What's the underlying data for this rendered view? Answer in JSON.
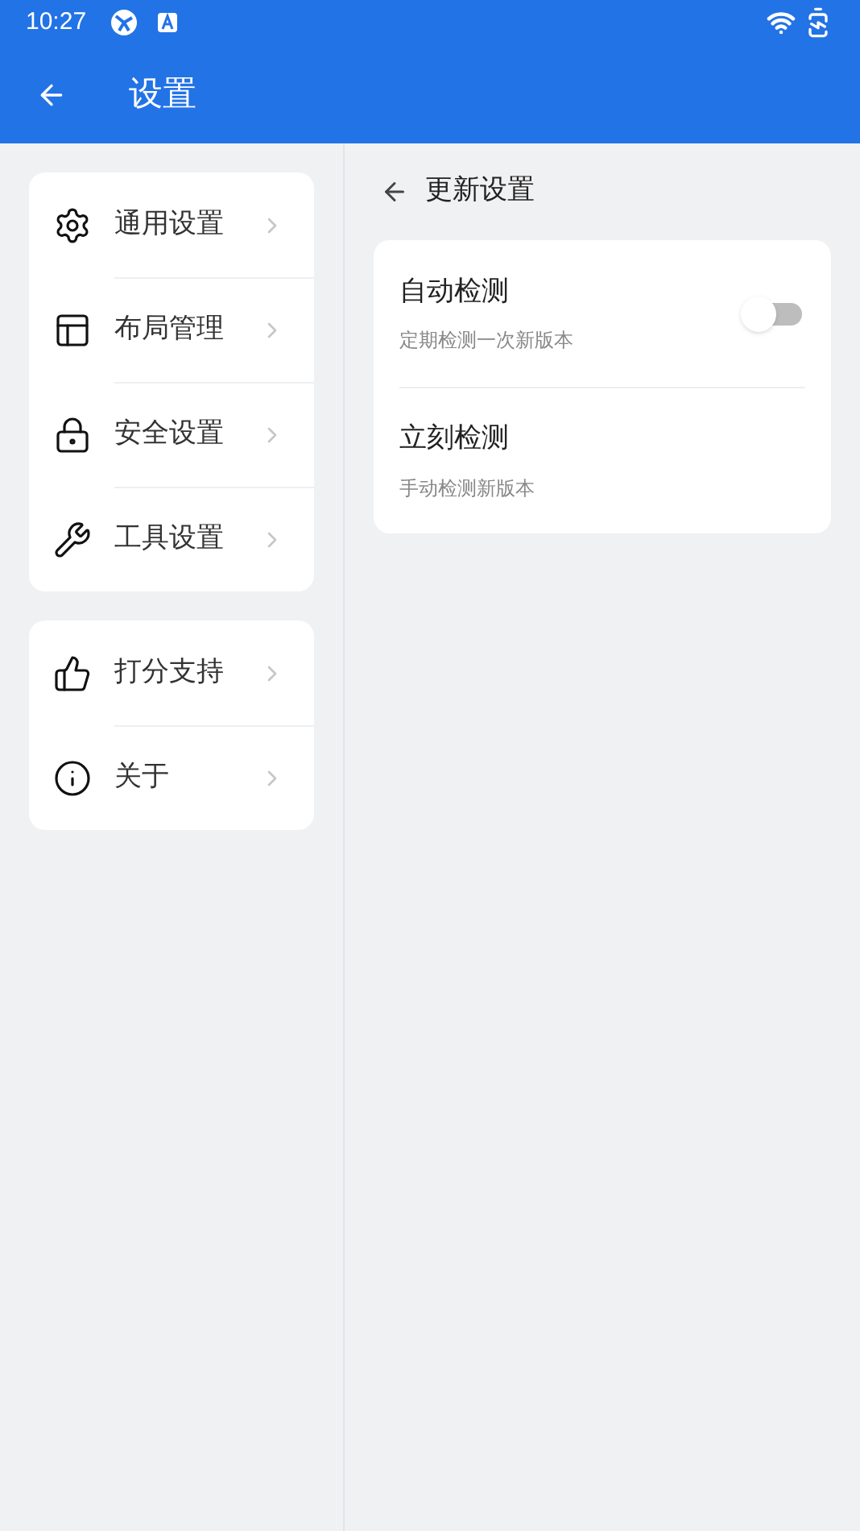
{
  "status_bar": {
    "time": "10:27"
  },
  "app_bar": {
    "title": "设置"
  },
  "sidebar": {
    "groups": [
      {
        "items": [
          {
            "label": "通用设置",
            "selected": false
          },
          {
            "label": "布局管理",
            "selected": false
          },
          {
            "label": "安全设置",
            "selected": false
          },
          {
            "label": "工具设置",
            "selected": false
          }
        ]
      },
      {
        "items": [
          {
            "label": "打分支持",
            "selected": false
          },
          {
            "label": "关于",
            "selected": false
          }
        ]
      }
    ]
  },
  "detail": {
    "title": "更新设置",
    "rows": [
      {
        "kind": "toggle",
        "title": "自动检测",
        "subtitle": "定期检测一次新版本",
        "on": false
      },
      {
        "kind": "plain",
        "title": "立刻检测",
        "subtitle": "手动检测新版本"
      }
    ]
  }
}
